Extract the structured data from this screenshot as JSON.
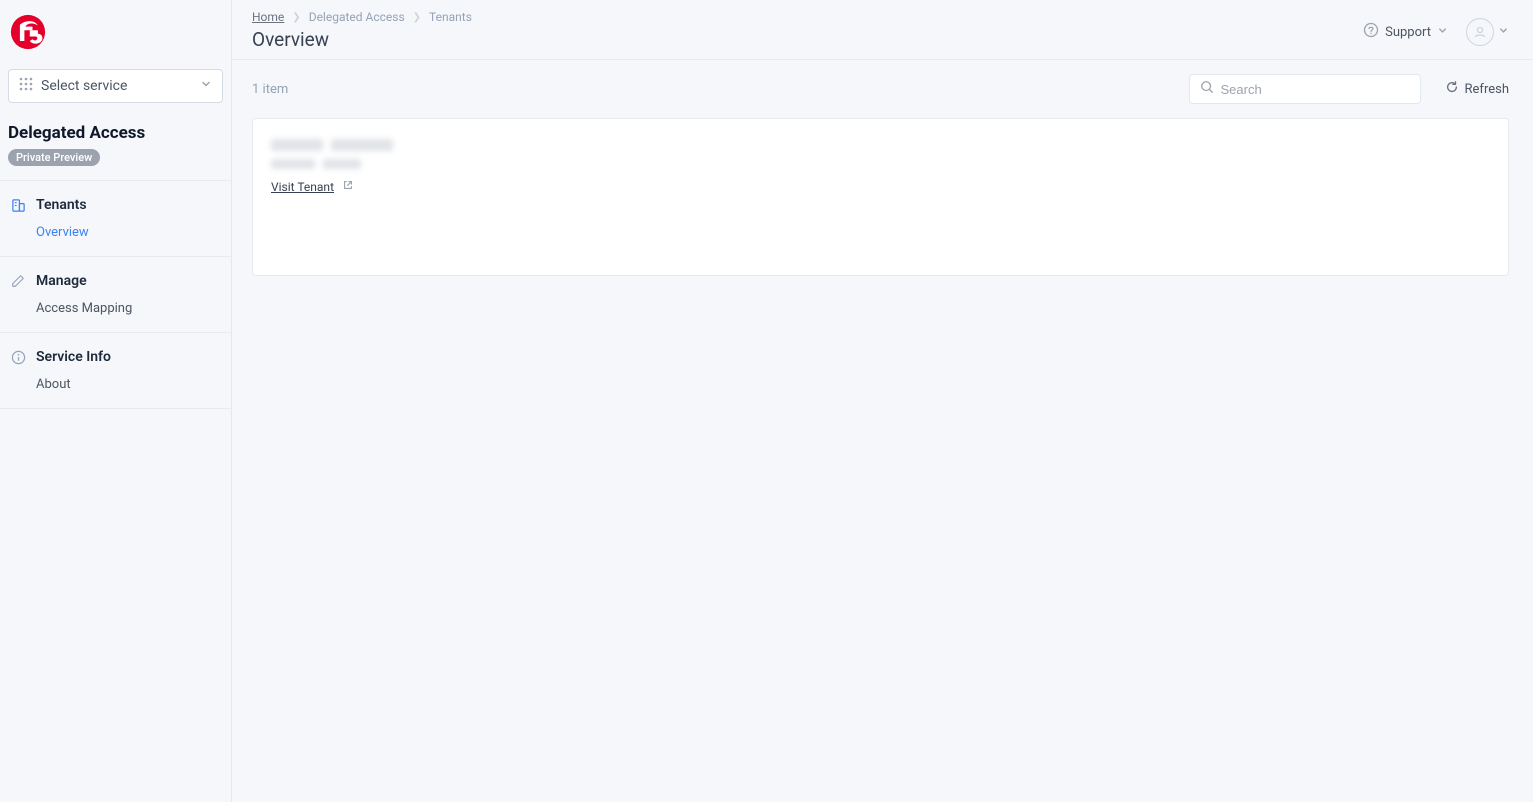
{
  "sidebar": {
    "service_selector_label": "Select service",
    "product_title": "Delegated Access",
    "product_badge": "Private Preview",
    "sections": [
      {
        "header": "Tenants",
        "items": [
          {
            "label": "Overview",
            "active": true
          }
        ]
      },
      {
        "header": "Manage",
        "items": [
          {
            "label": "Access Mapping",
            "active": false
          }
        ]
      },
      {
        "header": "Service Info",
        "items": [
          {
            "label": "About",
            "active": false
          }
        ]
      }
    ]
  },
  "header": {
    "breadcrumbs": [
      "Home",
      "Delegated Access",
      "Tenants"
    ],
    "page_title": "Overview",
    "support_label": "Support"
  },
  "toolbar": {
    "item_count": "1 item",
    "search_placeholder": "Search",
    "refresh_label": "Refresh"
  },
  "card": {
    "visit_link": "Visit Tenant"
  }
}
